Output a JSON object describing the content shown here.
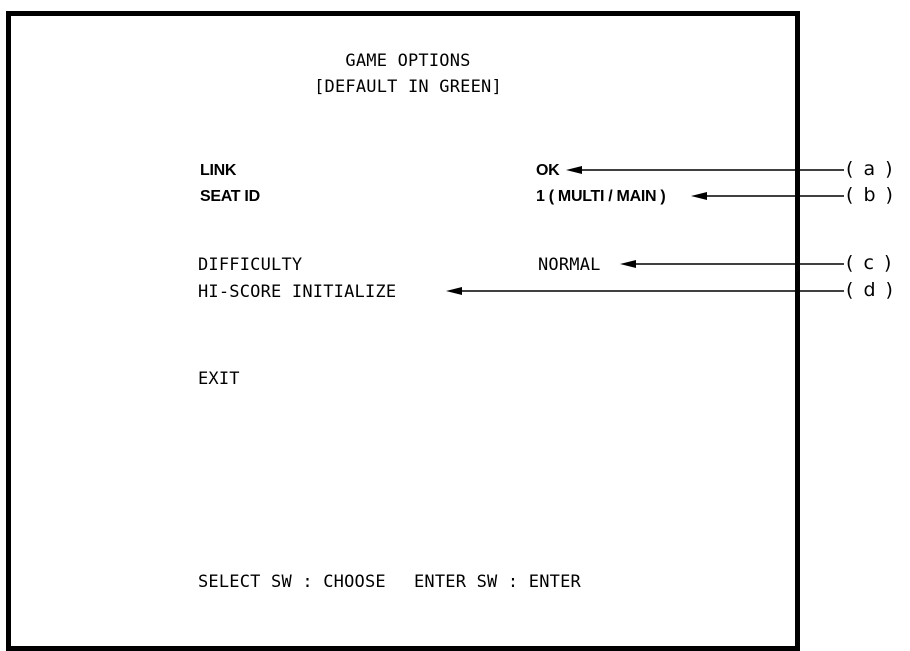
{
  "header": {
    "title": "GAME OPTIONS",
    "subtitle": "[DEFAULT IN GREEN]"
  },
  "options": [
    {
      "label": "LINK",
      "value": "OK"
    },
    {
      "label": "SEAT ID",
      "value": "1 ( MULTI / MAIN )"
    },
    {
      "label": "DIFFICULTY",
      "value": "NORMAL"
    },
    {
      "label": "HI-SCORE INITIALIZE",
      "value": ""
    }
  ],
  "exit_label": "EXIT",
  "footer": {
    "select_hint": "SELECT SW : CHOOSE",
    "enter_hint": "ENTER SW : ENTER"
  },
  "callouts": [
    {
      "label": "( a )",
      "target": "LINK value"
    },
    {
      "label": "( b )",
      "target": "SEAT ID value"
    },
    {
      "label": "( c )",
      "target": "DIFFICULTY value"
    },
    {
      "label": "( d )",
      "target": "HI-SCORE INITIALIZE"
    }
  ],
  "colors": {
    "frame": "#000000",
    "text": "#000000",
    "background": "#ffffff"
  }
}
